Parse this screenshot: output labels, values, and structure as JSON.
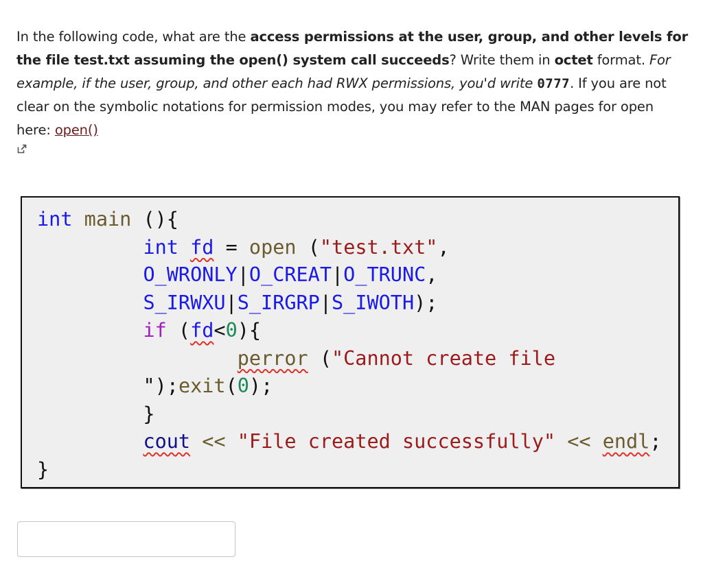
{
  "question": {
    "parts": {
      "p1": "In the following code, what are the ",
      "b1": "access permissions at the user, group, and other levels for the file test.txt assuming the open() system call succeeds",
      "p2": "? Write them in ",
      "b2": "octet",
      "p3": " format. ",
      "i1": "For example, if the user, group, and other each had RWX permissions, you'd write ",
      "mono": "0777",
      "p4": ". If you are not clear on the symbolic notations for permission modes, you may refer to the MAN pages for open here: ",
      "link": "open()"
    },
    "link_icon": "external-link-icon",
    "link_color": "#6b1d1d"
  },
  "code": {
    "lines": [
      [
        {
          "t": "int",
          "c": "kw"
        },
        {
          "t": " "
        },
        {
          "t": "main",
          "c": "fn"
        },
        {
          "t": " (){"
        }
      ],
      [
        {
          "t": "         "
        },
        {
          "t": "int",
          "c": "kw"
        },
        {
          "t": " "
        },
        {
          "t": "fd",
          "c": "kw squig"
        },
        {
          "t": " = "
        },
        {
          "t": "open",
          "c": "fn"
        },
        {
          "t": " ("
        },
        {
          "t": "\"test.txt\"",
          "c": "str"
        },
        {
          "t": ","
        }
      ],
      [
        {
          "t": "         "
        },
        {
          "t": "O_WRONLY",
          "c": "kw"
        },
        {
          "t": "|"
        },
        {
          "t": "O_CREAT",
          "c": "kw"
        },
        {
          "t": "|"
        },
        {
          "t": "O_TRUNC",
          "c": "kw"
        },
        {
          "t": ","
        }
      ],
      [
        {
          "t": "         "
        },
        {
          "t": "S_IRWXU",
          "c": "kw"
        },
        {
          "t": "|"
        },
        {
          "t": "S_IRGRP",
          "c": "kw"
        },
        {
          "t": "|"
        },
        {
          "t": "S_IWOTH",
          "c": "kw"
        },
        {
          "t": ");"
        }
      ],
      [
        {
          "t": "         "
        },
        {
          "t": "if",
          "c": "ctrl"
        },
        {
          "t": " ("
        },
        {
          "t": "fd",
          "c": "kw squig"
        },
        {
          "t": "<"
        },
        {
          "t": "0",
          "c": "num"
        },
        {
          "t": "){"
        }
      ],
      [
        {
          "t": "                 "
        },
        {
          "t": "perror",
          "c": "fn squig"
        },
        {
          "t": " ("
        },
        {
          "t": "\"Cannot create file",
          "c": "str"
        }
      ],
      [
        {
          "t": "         "
        },
        {
          "t": "\""
        },
        {
          "t": ");"
        },
        {
          "t": "exit",
          "c": "fn"
        },
        {
          "t": "("
        },
        {
          "t": "0",
          "c": "num"
        },
        {
          "t": ");"
        }
      ],
      [
        {
          "t": "         }"
        }
      ],
      [
        {
          "t": "         "
        },
        {
          "t": "cout",
          "c": "obj squig"
        },
        {
          "t": " "
        },
        {
          "t": "<<",
          "c": "fn"
        },
        {
          "t": " "
        },
        {
          "t": "\"File created successfully\"",
          "c": "str"
        },
        {
          "t": " "
        },
        {
          "t": "<<",
          "c": "fn"
        },
        {
          "t": " "
        },
        {
          "t": "endl",
          "c": "fn squig"
        },
        {
          "t": ";"
        }
      ],
      [
        {
          "t": "}"
        }
      ]
    ]
  },
  "answer": {
    "value": "",
    "placeholder": ""
  }
}
